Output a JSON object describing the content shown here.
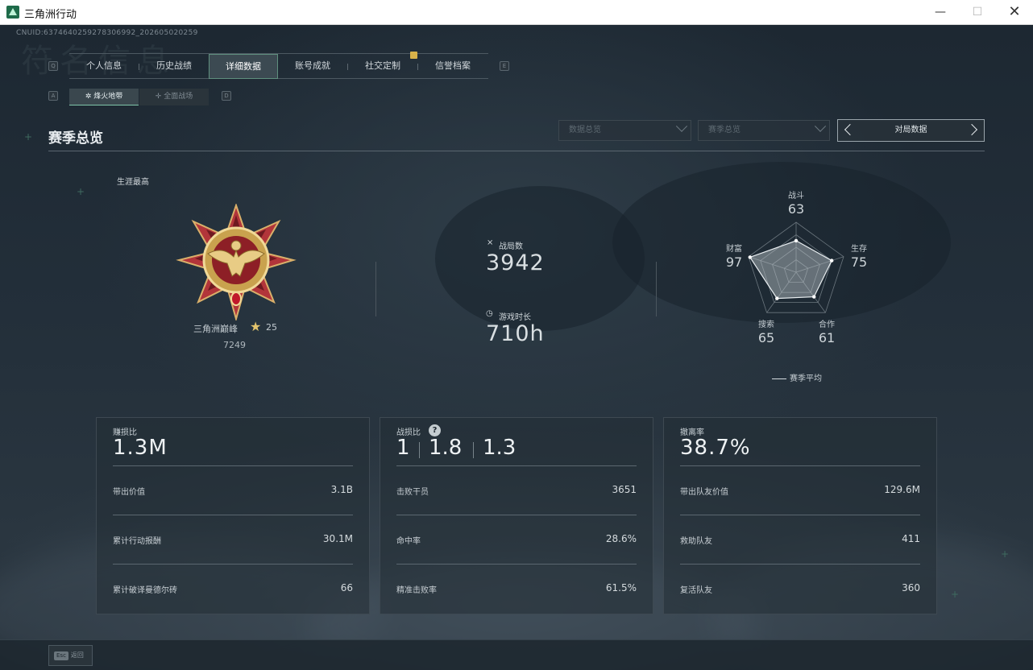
{
  "window": {
    "title": "三角洲行动",
    "minimize": "—",
    "maximize": "☐",
    "close": "✕"
  },
  "uid": "CNUID:6374640259278306992_202605020259",
  "bg_title": "符名信息",
  "key_hints": {
    "tab_prev": "Q",
    "tab_next": "E",
    "sub_prev": "A",
    "sub_next": "D"
  },
  "tabs": [
    {
      "label": "个人信息",
      "active": false
    },
    {
      "label": "历史战绩",
      "active": false
    },
    {
      "label": "详细数据",
      "active": true
    },
    {
      "label": "账号成就",
      "active": false
    },
    {
      "label": "社交定制",
      "active": false
    },
    {
      "label": "信誉档案",
      "active": false
    }
  ],
  "subtabs": {
    "active": "✲ 烽火地带",
    "inactive": "✛ 全面战场"
  },
  "section": {
    "title": "赛季总览"
  },
  "filters": {
    "dropdown1": "数据总览",
    "dropdown2": "赛季总览",
    "pager": "对局数据"
  },
  "rank": {
    "career_label": "生涯最高",
    "name": "三角洲巅峰",
    "star": "★",
    "level": "25",
    "score": "7249"
  },
  "stats": {
    "matches_icon": "⨯",
    "matches_label": "战局数",
    "matches_value": "3942",
    "time_icon": "◷",
    "time_label": "游戏时长",
    "time_value": "710h"
  },
  "radar": {
    "axes": [
      {
        "label": "战斗",
        "value": "63"
      },
      {
        "label": "生存",
        "value": "75"
      },
      {
        "label": "合作",
        "value": "61"
      },
      {
        "label": "搜索",
        "value": "65"
      },
      {
        "label": "财富",
        "value": "97"
      }
    ],
    "values": [
      63,
      75,
      61,
      65,
      97
    ],
    "max": 100,
    "legend": "赛季平均"
  },
  "panels": {
    "profit": {
      "label": "赚损比",
      "value": "1.3M",
      "rows": [
        {
          "label": "带出价值",
          "value": "3.1B"
        },
        {
          "label": "累计行动报酬",
          "value": "30.1M"
        },
        {
          "label": "累计破译曼德尔砖",
          "value": "66"
        }
      ]
    },
    "combat": {
      "label": "战损比",
      "help": "?",
      "values": [
        "1",
        "1.8",
        "1.3"
      ],
      "rows": [
        {
          "label": "击败干员",
          "value": "3651"
        },
        {
          "label": "命中率",
          "value": "28.6%"
        },
        {
          "label": "精准击败率",
          "value": "61.5%"
        }
      ]
    },
    "extract": {
      "label": "撤离率",
      "value": "38.7%",
      "rows": [
        {
          "label": "带出队友价值",
          "value": "129.6M"
        },
        {
          "label": "救助队友",
          "value": "411"
        },
        {
          "label": "复活队友",
          "value": "360"
        }
      ]
    }
  },
  "footer": {
    "esc_key": "Esc",
    "esc_label": "返回"
  },
  "colors": {
    "accent": "#7fc6a9",
    "gold": "#e3c46d",
    "medal_red": "#8b1d22"
  }
}
